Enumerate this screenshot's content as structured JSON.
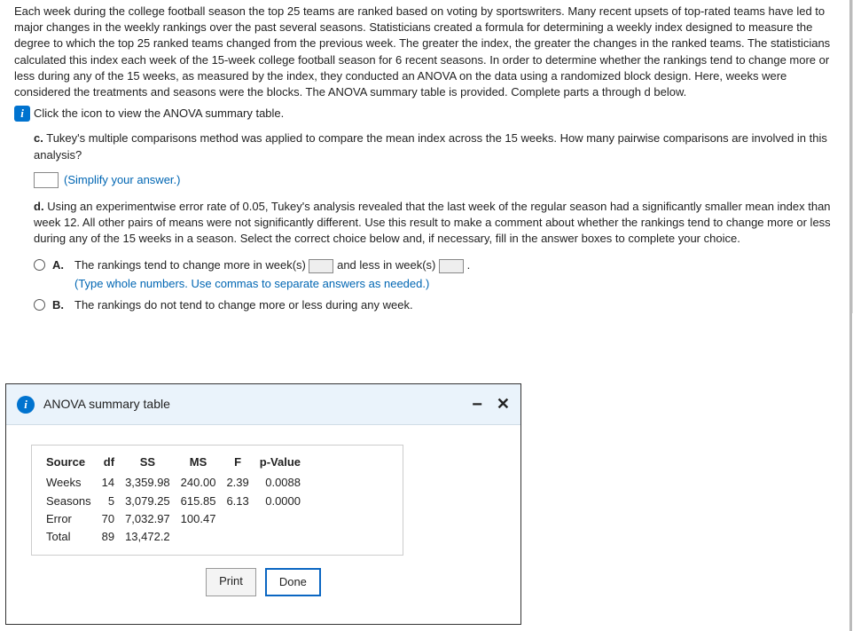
{
  "intro": "Each week during the college football season the top 25 teams are ranked based on voting by sportswriters. Many recent upsets of top-rated teams have led to major changes in the weekly rankings over the past several seasons. Statisticians created a formula for determining a weekly index designed to measure the degree to which the top 25 ranked teams changed from the previous week. The greater the index, the greater the changes in the ranked teams. The statisticians calculated this index each week of the 15-week college football season for 6 recent seasons. In order to determine whether the rankings tend to change more or less during any of the 15 weeks, as measured by the index, they conducted an ANOVA on the data using a randomized block design. Here, weeks were considered the treatments and seasons were the blocks. The ANOVA summary table is provided. Complete parts a through d below.",
  "viewLink": "Click the icon to view the ANOVA summary table.",
  "partC": {
    "label": "c.",
    "text": "Tukey's multiple comparisons method was applied to compare the mean index across the 15 weeks. How many pairwise comparisons are involved in this analysis?",
    "helper": "(Simplify your answer.)"
  },
  "partD": {
    "label": "d.",
    "text": "Using an experimentwise error rate of 0.05, Tukey's analysis revealed that the last week of the regular season had a significantly smaller mean index than week 12. All other pairs of means were not significantly different. Use this result to make a comment about whether the rankings tend to change more or less during any of the 15 weeks in a season. Select the correct choice below and, if necessary, fill in the answer boxes to complete your choice."
  },
  "choices": {
    "A": {
      "letter": "A.",
      "pre": "The rankings tend to change more in week(s) ",
      "mid": " and less in week(s) ",
      "post": ".",
      "helper": "(Type whole numbers. Use commas to separate answers as needed.)"
    },
    "B": {
      "letter": "B.",
      "text": "The rankings do not tend to change more or less during any week."
    }
  },
  "popup": {
    "title": "ANOVA summary table",
    "headers": [
      "Source",
      "df",
      "SS",
      "MS",
      "F",
      "p-Value"
    ],
    "rows": [
      {
        "source": "Weeks",
        "df": "14",
        "ss": "3,359.98",
        "ms": "240.00",
        "f": "2.39",
        "p": "0.0088"
      },
      {
        "source": "Seasons",
        "df": "5",
        "ss": "3,079.25",
        "ms": "615.85",
        "f": "6.13",
        "p": "0.0000"
      },
      {
        "source": "Error",
        "df": "70",
        "ss": "7,032.97",
        "ms": "100.47",
        "f": "",
        "p": ""
      },
      {
        "source": "Total",
        "df": "89",
        "ss": "13,472.2",
        "ms": "",
        "f": "",
        "p": ""
      }
    ],
    "print": "Print",
    "done": "Done"
  }
}
